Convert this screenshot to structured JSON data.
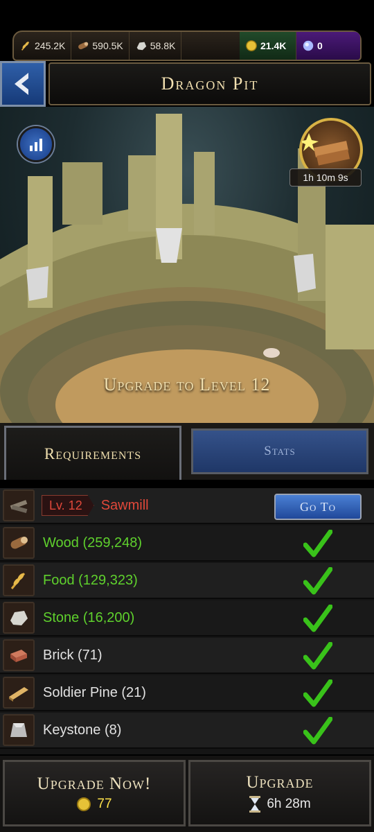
{
  "resources": {
    "food": "245.2K",
    "wood": "590.5K",
    "stone": "58.8K",
    "gold": "21.4K",
    "gems": "0"
  },
  "header": {
    "title": "Dragon Pit"
  },
  "scene": {
    "timer": "1h 10m 9s",
    "upgrade_heading": "Upgrade to Level 12"
  },
  "tabs": {
    "requirements": "Requirements",
    "stats": "Stats"
  },
  "requirements": {
    "building": {
      "level": "Lv. 12",
      "name": "Sawmill",
      "goto_label": "Go To"
    },
    "items": [
      {
        "label": "Wood (259,248)",
        "icon": "wood-icon",
        "met": true,
        "color": "#5fd12d"
      },
      {
        "label": "Food (129,323)",
        "icon": "food-icon",
        "met": true,
        "color": "#5fd12d"
      },
      {
        "label": "Stone (16,200)",
        "icon": "stone-icon",
        "met": true,
        "color": "#5fd12d"
      },
      {
        "label": "Brick (71)",
        "icon": "brick-icon",
        "met": true,
        "color": "#e2e2e2"
      },
      {
        "label": "Soldier Pine (21)",
        "icon": "soldier-pine-icon",
        "met": true,
        "color": "#e2e2e2"
      },
      {
        "label": "Keystone (8)",
        "icon": "keystone-icon",
        "met": true,
        "color": "#e2e2e2"
      }
    ]
  },
  "actions": {
    "upgrade_now": {
      "label": "Upgrade Now!",
      "cost": "77"
    },
    "upgrade": {
      "label": "Upgrade",
      "time": "6h 28m"
    }
  }
}
